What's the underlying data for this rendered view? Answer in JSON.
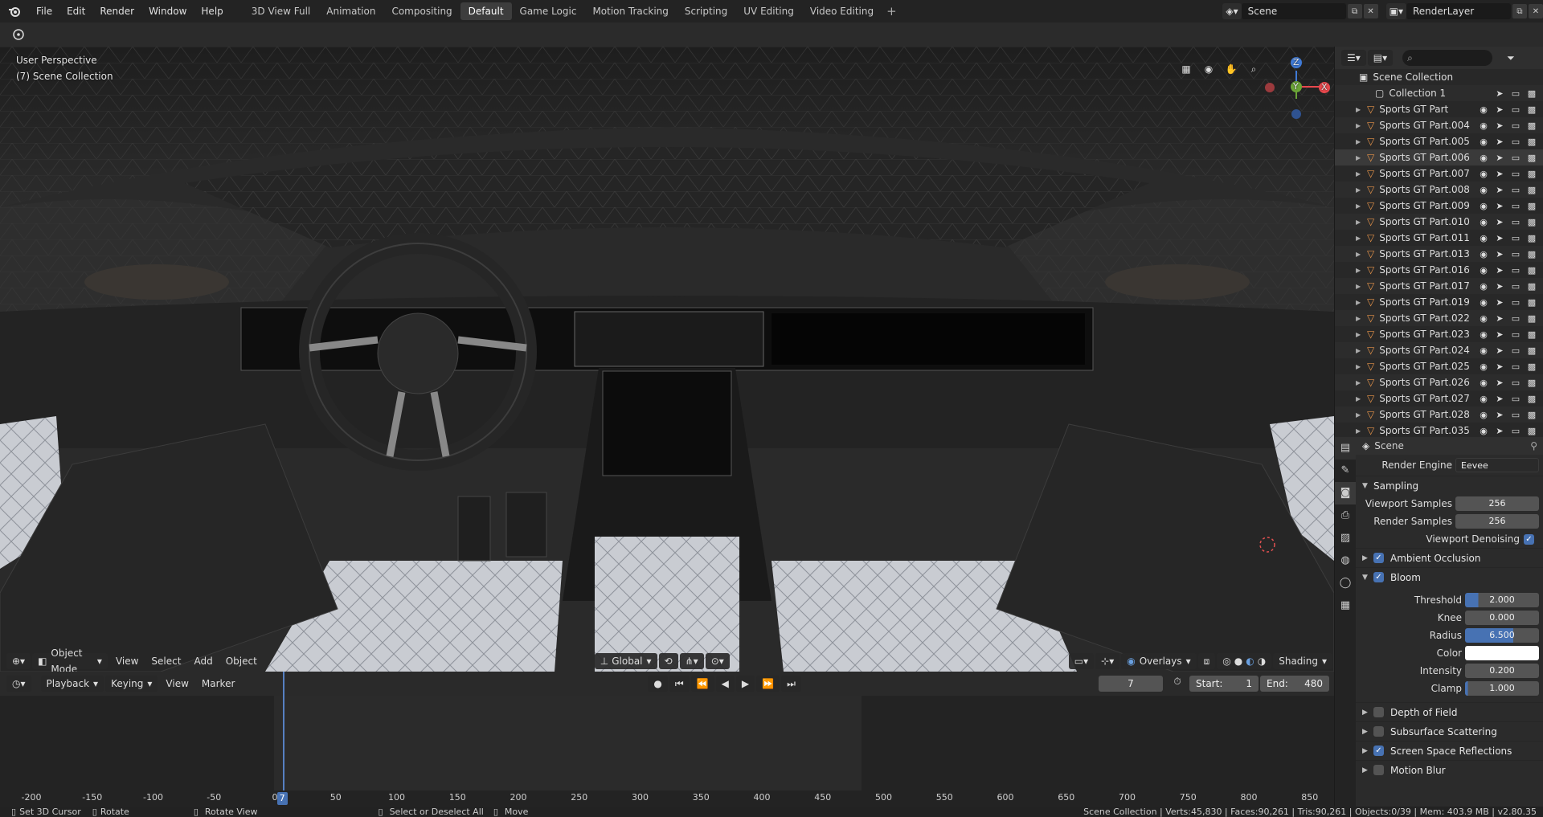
{
  "menu": [
    "File",
    "Edit",
    "Render",
    "Window",
    "Help"
  ],
  "workspaces": [
    "3D View Full",
    "Animation",
    "Compositing",
    "Default",
    "Game Logic",
    "Motion Tracking",
    "Scripting",
    "UV Editing",
    "Video Editing"
  ],
  "active_workspace": "Default",
  "scene_selector": {
    "label": "Scene"
  },
  "layer_selector": {
    "label": "RenderLayer"
  },
  "viewport": {
    "view_name": "User Perspective",
    "collection": "(7) Scene Collection",
    "gizmo_axes": {
      "z": "Z",
      "y": "Y",
      "x": "X"
    },
    "header": {
      "mode": "Object Mode",
      "view": "View",
      "select": "Select",
      "add": "Add",
      "object": "Object",
      "orientation": "Global",
      "overlays": "Overlays",
      "shading": "Shading"
    }
  },
  "timeline": {
    "playback": "Playback",
    "keying": "Keying",
    "view": "View",
    "marker": "Marker",
    "current_frame": "7",
    "start_label": "Start:",
    "start": "1",
    "end_label": "End:",
    "end": "480",
    "ticks": [
      "-200",
      "-150",
      "-100",
      "-50",
      "0",
      "50",
      "100",
      "150",
      "200",
      "250",
      "300",
      "350",
      "400",
      "450",
      "500",
      "550",
      "600",
      "650",
      "700",
      "750",
      "800",
      "850"
    ],
    "current_frame_value": 7,
    "frame_start": 1,
    "frame_end": 480
  },
  "outliner": {
    "root": "Scene Collection",
    "collection": "Collection 1",
    "objects": [
      "Sports GT Part",
      "Sports GT Part.004",
      "Sports GT Part.005",
      "Sports GT Part.006",
      "Sports GT Part.007",
      "Sports GT Part.008",
      "Sports GT Part.009",
      "Sports GT Part.010",
      "Sports GT Part.011",
      "Sports GT Part.013",
      "Sports GT Part.016",
      "Sports GT Part.017",
      "Sports GT Part.019",
      "Sports GT Part.022",
      "Sports GT Part.023",
      "Sports GT Part.024",
      "Sports GT Part.025",
      "Sports GT Part.026",
      "Sports GT Part.027",
      "Sports GT Part.028",
      "Sports GT Part.035"
    ],
    "highlighted_index": 3
  },
  "properties": {
    "header": "Scene",
    "render_engine_label": "Render Engine",
    "render_engine": "Eevee",
    "sampling": "Sampling",
    "viewport_samples_label": "Viewport Samples",
    "viewport_samples": "256",
    "render_samples_label": "Render Samples",
    "render_samples": "256",
    "viewport_denoising": "Viewport Denoising",
    "ambient_occlusion": "Ambient Occlusion",
    "bloom": "Bloom",
    "threshold_label": "Threshold",
    "threshold": "2.000",
    "knee_label": "Knee",
    "knee": "0.000",
    "radius_label": "Radius",
    "radius": "6.500",
    "color_label": "Color",
    "intensity_label": "Intensity",
    "intensity": "0.200",
    "clamp_label": "Clamp",
    "clamp": "1.000",
    "depth_of_field": "Depth of Field",
    "subsurface": "Subsurface Scattering",
    "ssr": "Screen Space Reflections",
    "motion_blur": "Motion Blur"
  },
  "status": {
    "set_cursor": "Set 3D Cursor",
    "rotate": "Rotate",
    "rotate_view": "Rotate View",
    "select": "Select or Deselect All",
    "move": "Move",
    "stats": "Scene Collection | Verts:45,830 | Faces:90,261 | Tris:90,261 | Objects:0/39 | Mem: 403.9 MB | v2.80.35"
  },
  "colors": {
    "accent": "#4772b3",
    "x_axis": "#e8484d",
    "y_axis": "#6ba437",
    "z_axis": "#3f7ad6",
    "mesh_icon": "#e8954a"
  }
}
